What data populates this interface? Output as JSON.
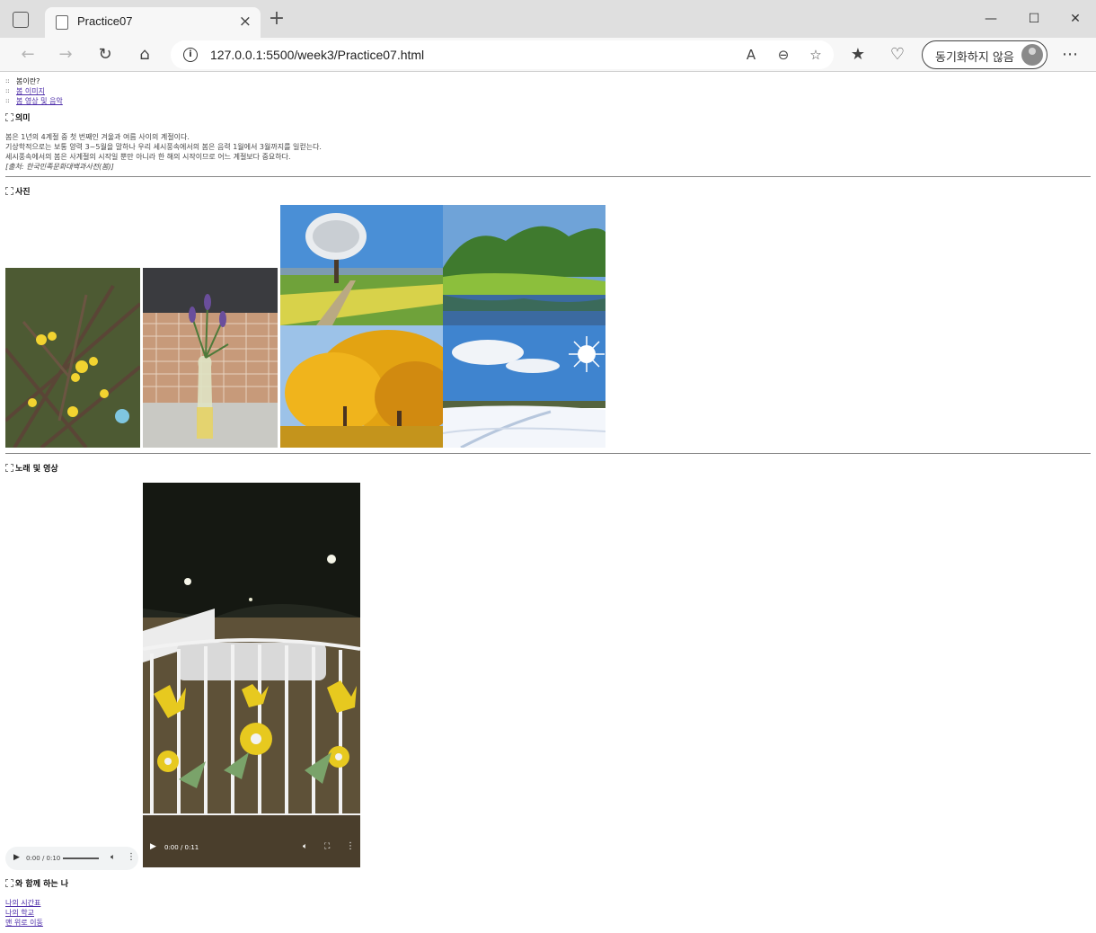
{
  "browser": {
    "tab_title": "Practice07",
    "tab_close": "×",
    "new_tab": "+",
    "url": "127.0.0.1:5500/week3/Practice07.html",
    "profile_label": "동기화하지 않음",
    "window_controls": {
      "minimize": "—",
      "maximize": "☐",
      "close": "✕"
    },
    "icons": [
      "back-arrow-icon",
      "forward-arrow-icon",
      "refresh-icon",
      "home-icon",
      "info-icon",
      "read-aloud-icon",
      "zoom-out-icon",
      "add-favorite-icon",
      "favorites-icon",
      "browser-essentials-icon",
      "more-icon"
    ]
  },
  "page": {
    "nav": [
      {
        "label": "봄이란?",
        "link": false
      },
      {
        "label": "봄 이미지",
        "link": true
      },
      {
        "label": "봄 영상 및 음악",
        "link": true
      }
    ],
    "sections": {
      "meaning": "의미",
      "photos": "사진",
      "media": "노래 및 영상",
      "together": "와 함께 하는 나"
    },
    "meaning_lines": [
      "봄은 1년의 4계절 중 첫 번째인 겨울과 여름 사이의 계절이다.",
      "기상학적으로는 보통 양력 3~5월을 말하나 우리 세시풍속에서의 봄은 음력 1월에서 3월까지를 일컫는다.",
      "세시풍속에서의 봄은 사계절의 시작일 뿐만 아니라 한 해의 시작이므로 어느 계절보다 중요하다."
    ],
    "source": "[출처: 한국민족문화대백과사전(봄)]",
    "photos": [
      "forsythia-branch-photo",
      "lavender-vase-photo",
      "spring-tree-field-photo",
      "summer-lake-photo",
      "autumn-trees-photo",
      "winter-snow-photo"
    ],
    "audio": {
      "time": "0:00 / 0:10"
    },
    "video": {
      "time": "0:00 / 0:11"
    },
    "links": [
      "나의 시간표",
      "나의 학교",
      "맨 위로 이동"
    ]
  }
}
